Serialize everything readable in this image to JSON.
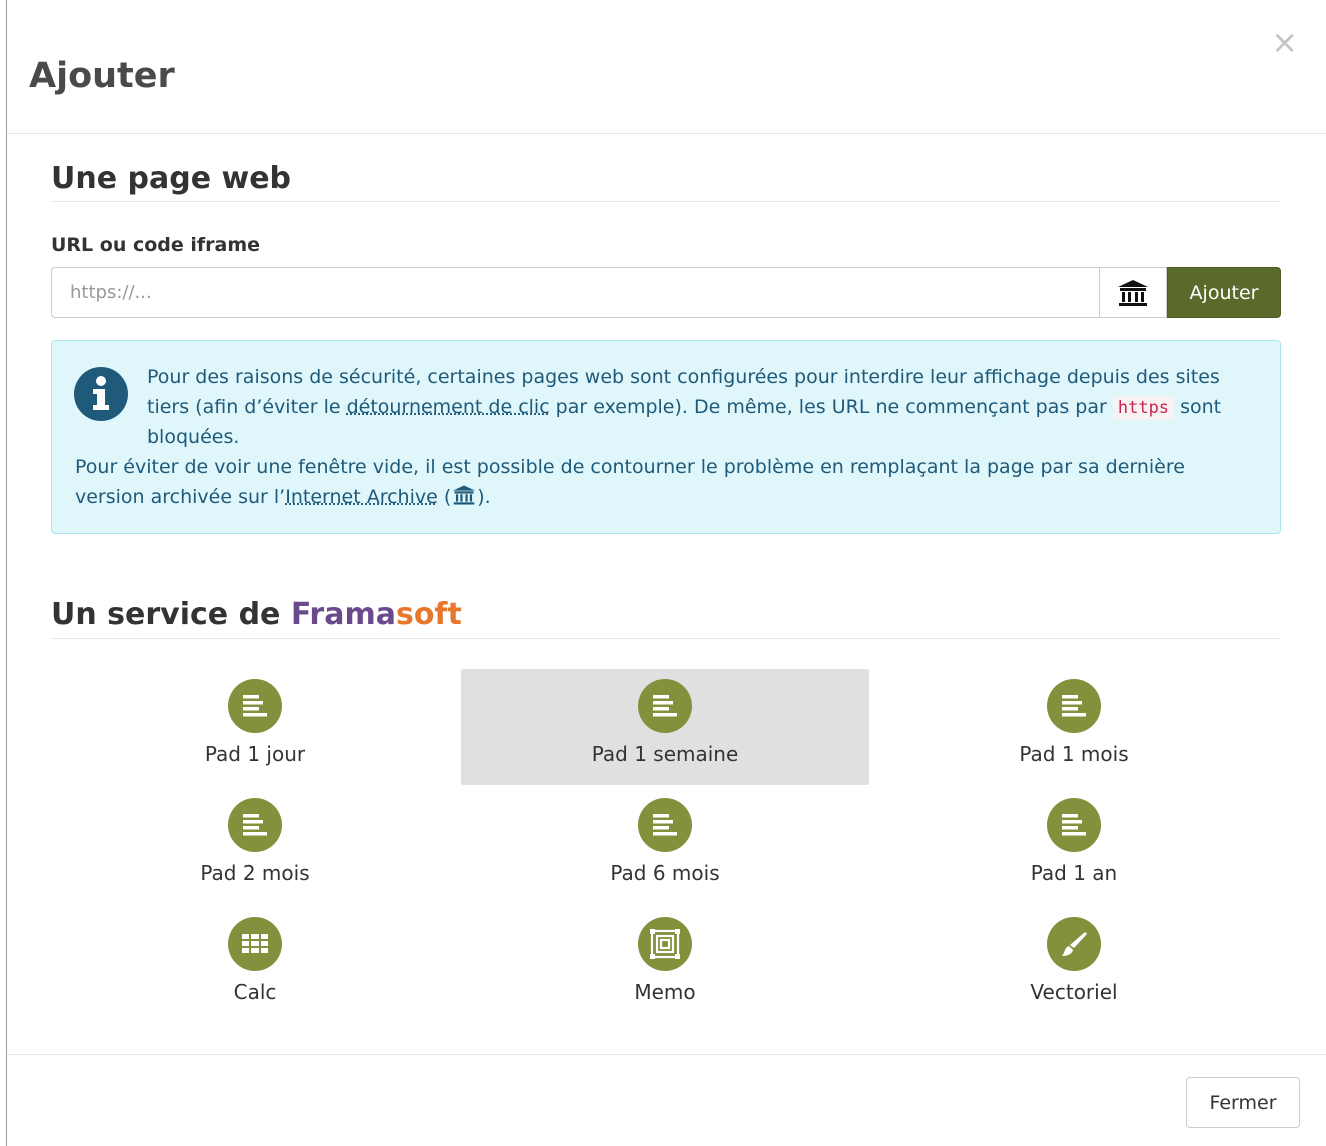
{
  "modal": {
    "title": "Ajouter",
    "close_glyph": "×"
  },
  "webpage": {
    "section_title": "Une page web",
    "url_label": "URL ou code iframe",
    "url_placeholder": "https://...",
    "url_value": "",
    "archive_icon": "museum-icon",
    "add_label": "Ajouter"
  },
  "alert": {
    "icon": "info-icon",
    "p1_before_link": "Pour des raisons de sécurité, certaines pages web sont configurées pour interdire leur affichage depuis des sites tiers (afin d’éviter le ",
    "p1_link": "détournement de clic",
    "p1_after_link": " par exemple). De même, les URL ne commençant pas par ",
    "p1_code": "https",
    "p1_end": " sont bloquées.",
    "p2_before_link": "Pour éviter de voir une fenêtre vide, il est possible de contourner le problème en remplaçant la page par sa dernière version archivée sur l’",
    "p2_link": "Internet Archive",
    "p2_open": " (",
    "p2_close": ")."
  },
  "services": {
    "title_prefix": "Un service de ",
    "brand_part1": "Frama",
    "brand_part2": "soft",
    "brand_colors": {
      "frama": "#6a4a8c",
      "soft": "#e8772e"
    },
    "accent_color": "#84903c",
    "items": [
      {
        "label": "Pad 1 jour",
        "icon": "pad-icon",
        "selected": false
      },
      {
        "label": "Pad 1 semaine",
        "icon": "pad-icon",
        "selected": true
      },
      {
        "label": "Pad 1 mois",
        "icon": "pad-icon",
        "selected": false
      },
      {
        "label": "Pad 2 mois",
        "icon": "pad-icon",
        "selected": false
      },
      {
        "label": "Pad 6 mois",
        "icon": "pad-icon",
        "selected": false
      },
      {
        "label": "Pad 1 an",
        "icon": "pad-icon",
        "selected": false
      },
      {
        "label": "Calc",
        "icon": "grid-icon",
        "selected": false
      },
      {
        "label": "Memo",
        "icon": "memo-icon",
        "selected": false
      },
      {
        "label": "Vectoriel",
        "icon": "brush-icon",
        "selected": false
      }
    ]
  },
  "footer": {
    "close_label": "Fermer"
  }
}
